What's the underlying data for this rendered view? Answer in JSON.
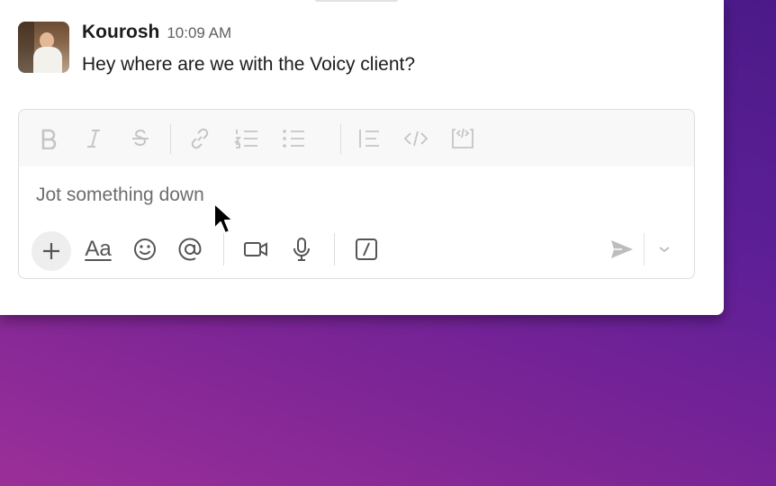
{
  "message": {
    "author": "Kourosh",
    "time": "10:09 AM",
    "text": "Hey where are we with the Voicy client?"
  },
  "composer": {
    "placeholder": "Jot something down",
    "value": "",
    "format_toolbar": [
      "bold-icon",
      "italic-icon",
      "strikethrough-icon",
      "link-icon",
      "ordered-list-icon",
      "bulleted-list-icon",
      "blockquote-icon",
      "code-icon",
      "code-block-icon"
    ],
    "aa_label": "Aa",
    "bottom_toolbar": [
      "plus-icon",
      "text-format-icon",
      "emoji-icon",
      "mention-icon",
      "video-icon",
      "microphone-icon",
      "slash-command-icon",
      "send-icon",
      "chevron-down-icon"
    ]
  },
  "colors": {
    "background_gradient": [
      "#9b2f98",
      "#4b1a88"
    ],
    "text": "#1d1c1d",
    "muted": "#616061",
    "toolbar_disabled": "#c5c5c5"
  }
}
